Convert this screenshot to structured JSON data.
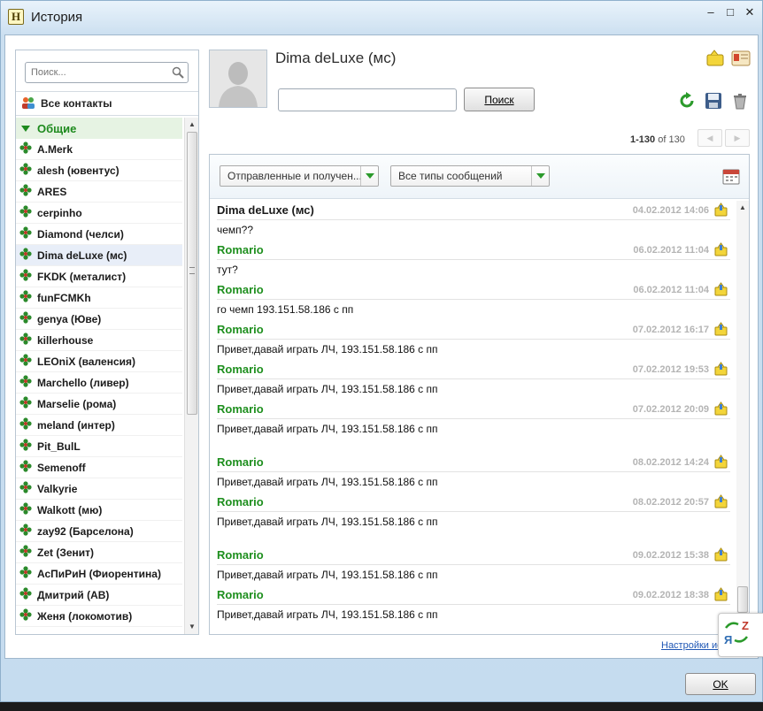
{
  "window": {
    "title": "История",
    "app_letter": "H"
  },
  "search": {
    "placeholder": "Поиск..."
  },
  "sidebar": {
    "all_contacts": "Все контакты",
    "group": "Общие",
    "contacts": [
      "A.Merk",
      "alesh (ювентус)",
      "ARES",
      "cerpinho",
      "Diamond (челси)",
      "Dima deLuxe (мс)",
      "FKDK (металист)",
      "funFCMKh",
      "genya (Юве)",
      "killerhouse",
      "LEOniX (валенсия)",
      "Marchello (ливер)",
      "Marselie (рома)",
      "meland (интер)",
      "Pit_BulL",
      "Semenoff",
      "Valkyrie",
      "Walkott (мю)",
      "zay92 (Барселона)",
      "Zet (Зенит)",
      "АсПиРиН (Фиорентина)",
      "Дмитрий (АВ)",
      "Женя (локомотив)"
    ],
    "selected_index": 5
  },
  "header": {
    "contact_name": "Dima deLuxe (мс)",
    "search_button": "Поиск"
  },
  "pager": {
    "range": "1-130",
    "of_label": "of",
    "total": "130"
  },
  "filters": {
    "direction": "Отправленные и получен...",
    "type": "Все типы сообщений"
  },
  "messages": [
    {
      "sender": "Dima deLuxe (мс)",
      "own": true,
      "time": "04.02.2012 14:06",
      "text": "чемп??",
      "tall": false
    },
    {
      "sender": "Romario",
      "own": false,
      "time": "06.02.2012 11:04",
      "text": "тут?",
      "tall": false
    },
    {
      "sender": "Romario",
      "own": false,
      "time": "06.02.2012 11:04",
      "text": "го чемп 193.151.58.186 с пп",
      "tall": false
    },
    {
      "sender": "Romario",
      "own": false,
      "time": "07.02.2012 16:17",
      "text": "Привет,давай играть ЛЧ, 193.151.58.186 с пп",
      "tall": false
    },
    {
      "sender": "Romario",
      "own": false,
      "time": "07.02.2012 19:53",
      "text": "Привет,давай играть ЛЧ, 193.151.58.186 с пп",
      "tall": false
    },
    {
      "sender": "Romario",
      "own": false,
      "time": "07.02.2012 20:09",
      "text": "Привет,давай играть ЛЧ, 193.151.58.186 с пп",
      "tall": true
    },
    {
      "sender": "Romario",
      "own": false,
      "time": "08.02.2012 14:24",
      "text": "Привет,давай играть ЛЧ, 193.151.58.186 с пп",
      "tall": false
    },
    {
      "sender": "Romario",
      "own": false,
      "time": "08.02.2012 20:57",
      "text": "Привет,давай играть ЛЧ, 193.151.58.186 с пп",
      "tall": true
    },
    {
      "sender": "Romario",
      "own": false,
      "time": "09.02.2012 15:38",
      "text": "Привет,давай играть ЛЧ, 193.151.58.186 с пп",
      "tall": false
    },
    {
      "sender": "Romario",
      "own": false,
      "time": "09.02.2012 18:38",
      "text": "Привет,давай играть ЛЧ, 193.151.58.186 с пп",
      "tall": false
    }
  ],
  "footer": {
    "settings_link": "Настройки ис",
    "ok_button": "OK"
  },
  "colors": {
    "sender": "#1e8f1e",
    "timestamp": "#b4b4b4",
    "link": "#1f57b5",
    "group_bg": "#e6f3e3"
  },
  "icons": [
    "search-icon",
    "contacts-icon",
    "flower-icon",
    "message-icon",
    "refresh-icon",
    "save-icon",
    "trash-icon",
    "calendar-icon",
    "chevron-down-icon"
  ]
}
